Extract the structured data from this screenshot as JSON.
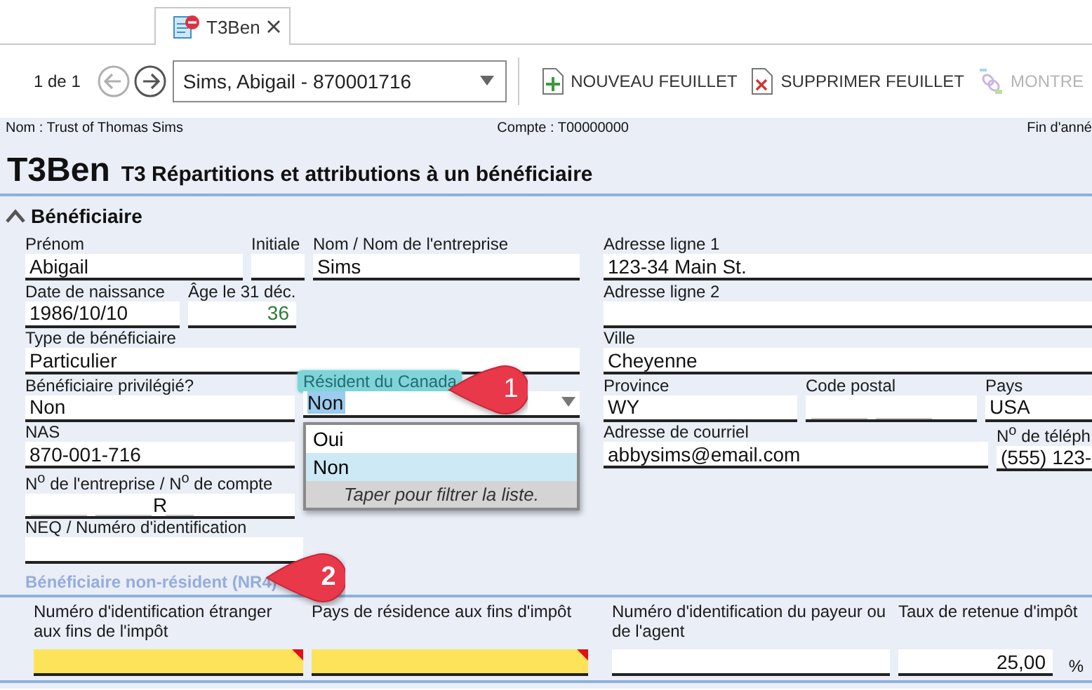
{
  "tab": {
    "label": "T3Ben"
  },
  "toolbar": {
    "pager": "1 de 1",
    "nav": [
      {
        "kind": "back",
        "disabled": true
      },
      {
        "kind": "forward",
        "disabled": false
      }
    ],
    "record_select": {
      "value": "Sims, Abigail - 870001716"
    },
    "actions": [
      {
        "kind": "new",
        "label": "NOUVEAU FEUILLET",
        "disabled": false
      },
      {
        "kind": "delete",
        "label": "SUPPRIMER FEUILLET",
        "disabled": false
      },
      {
        "kind": "show",
        "label": "MONTRE",
        "disabled": true
      }
    ]
  },
  "header": {
    "name": "Nom : Trust of Thomas Sims",
    "account": "Compte : T00000000",
    "year_end": "Fin d'anné"
  },
  "form_title": {
    "code": "T3Ben",
    "title": "T3 Répartitions et attributions à un bénéficiaire"
  },
  "section": {
    "title": "Bénéficiaire",
    "expanded": true
  },
  "left_rows": [
    [
      {
        "label": "Prénom",
        "value": "Abigail"
      },
      {
        "label": "Initiale"
      },
      {
        "label": "Nom / Nom de l'entreprise",
        "value": "Sims"
      }
    ],
    [
      {
        "label": "Date de naissance",
        "value": "1986/10/10"
      },
      {
        "label": "Âge le 31 déc.",
        "value": "36",
        "kind": "computed"
      }
    ],
    [
      {
        "label": "Type de bénéficiaire",
        "value": "Particulier"
      }
    ],
    [
      {
        "label": "Bénéficiaire privilégié?",
        "value": "Non"
      },
      {
        "label": "Résident du Canada",
        "value": "Non",
        "kind": "dropdown",
        "focused": true
      }
    ],
    [
      {
        "label": "NAS",
        "value": "870-001-716"
      }
    ],
    [
      {
        "label": "N$^{o}$ de l'entreprise / N$^{o}$ de compte",
        "value": "R",
        "kind": "masked"
      }
    ],
    [
      {
        "label": "NEQ / Numéro d'identification"
      }
    ]
  ],
  "right_rows": [
    [
      {
        "label": "Adresse ligne 1",
        "value": "123-34 Main St."
      }
    ],
    [
      {
        "label": "Adresse ligne 2"
      }
    ],
    [
      {
        "label": "Ville",
        "value": "Cheyenne"
      }
    ],
    [
      {
        "label": "Province",
        "value": "WY"
      },
      {
        "label": "Code postal",
        "kind": "masked"
      },
      {
        "label": "Pays",
        "value": "USA"
      }
    ],
    [
      {
        "label": "Adresse de courriel",
        "value": "abbysims@email.com"
      },
      {
        "label": "N$^{o}$ de téléph",
        "value": "(555) 123-"
      }
    ]
  ],
  "dropdown": {
    "options": [
      {
        "label": "Oui",
        "selected": false
      },
      {
        "label": "Non",
        "selected": true
      }
    ],
    "hint": "Taper pour filtrer la liste."
  },
  "nr4": {
    "title": "Bénéficiaire non-résident (NR4)",
    "fields": [
      {
        "label": "Numéro d'identification étranger aux fins de l'impôt",
        "required": true
      },
      {
        "label": "Pays de résidence aux fins d'impôt",
        "required": true
      },
      {
        "label": "Numéro d'identification du payeur ou de l'agent"
      },
      {
        "label": "Taux de retenue d'impôt",
        "value": "25,00",
        "kind": "number",
        "unit": "%"
      }
    ]
  },
  "callouts": [
    {
      "number": "1"
    },
    {
      "number": "2"
    }
  ]
}
